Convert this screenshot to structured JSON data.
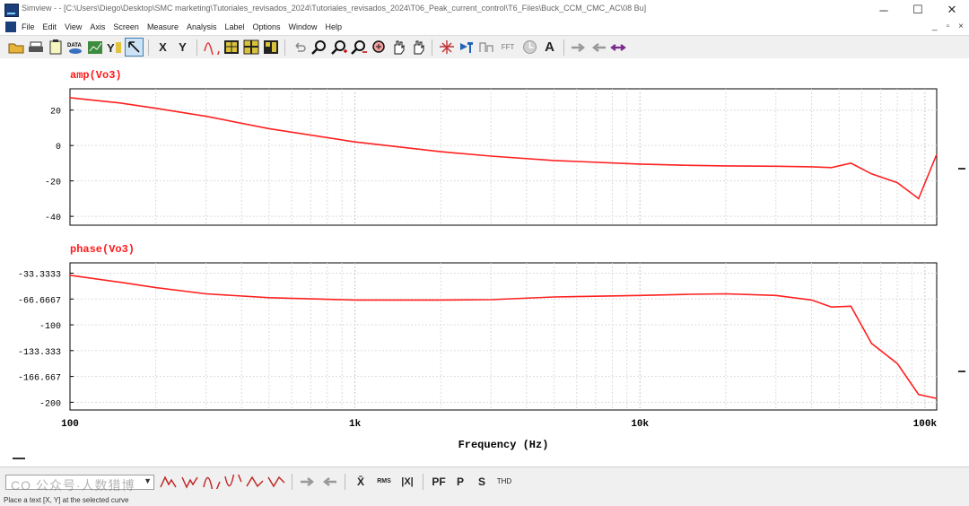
{
  "window": {
    "title": "Simview - - [C:\\Users\\Diego\\Desktop\\SMC marketing\\Tutoriales_revisados_2024\\Tutoriales_revisados_2024\\T06_Peak_current_control\\T6_Files\\Buck_CCM_CMC_AC\\08 Bu]",
    "minimize_glyph": "─",
    "maximize_glyph": "☐",
    "close_glyph": "✕"
  },
  "menu": {
    "items": [
      "File",
      "Edit",
      "View",
      "Axis",
      "Screen",
      "Measure",
      "Analysis",
      "Label",
      "Options",
      "Window",
      "Help"
    ],
    "mdi": [
      "_",
      "▫",
      "×"
    ]
  },
  "toolbar": {
    "data_label": "DATA",
    "x_label": "X",
    "y_label": "Y",
    "fft_label": "FFT",
    "text_label": "A",
    "icons": [
      "open-folder-icon",
      "print-icon",
      "clipboard-icon",
      "data-icon",
      "chart-icon",
      "axis-icon",
      "select-arrow-icon",
      "x-axis-icon",
      "y-axis-icon",
      "waveform-icon",
      "grid-icon",
      "screen-icon",
      "screen2-icon",
      "undo-icon",
      "zoom-icon",
      "zoom-in-icon",
      "zoom-out-icon",
      "zoom-fit-icon",
      "pan-icon",
      "hand-icon",
      "measure-icon",
      "probe-icon",
      "analysis-icon",
      "fft-icon",
      "clock-icon",
      "text-icon",
      "arrow-right-icon",
      "arrow-left-icon",
      "arrow-both-icon"
    ]
  },
  "colors": {
    "curve": "#ff2020",
    "title": "#ff1a1a",
    "grid": "#dcdcdc",
    "axis_text": "#000000"
  },
  "chart_data": [
    {
      "type": "line",
      "title": "amp(Vo3)",
      "xlabel": "Frequency (Hz)",
      "xscale": "log",
      "xlim": [
        100,
        110000
      ],
      "ylim": [
        -45,
        32
      ],
      "yticks": [
        20,
        0,
        -20,
        -40
      ],
      "series": [
        {
          "x": [
            100,
            150,
            200,
            300,
            500,
            1000,
            2000,
            3000,
            5000,
            10000,
            15000,
            20000,
            30000,
            40000,
            47000,
            55000,
            65000,
            80000,
            95000,
            110000
          ],
          "y": [
            27,
            24,
            21,
            16.5,
            9.5,
            2,
            -3.5,
            -6,
            -8.5,
            -10.5,
            -11.2,
            -11.5,
            -11.7,
            -12,
            -12.5,
            -10,
            -16,
            -21,
            -30,
            -5
          ]
        }
      ]
    },
    {
      "type": "line",
      "title": "phase(Vo3)",
      "xlabel": "Frequency (Hz)",
      "xscale": "log",
      "xlim": [
        100,
        110000
      ],
      "ylim": [
        -210,
        -20
      ],
      "yticks": [
        "-33.3333",
        "-66.6667",
        "-100",
        "-133.333",
        "-166.667",
        "-200"
      ],
      "xticks": [
        "100",
        "1k",
        "10k",
        "100k"
      ],
      "series": [
        {
          "x": [
            100,
            150,
            200,
            300,
            500,
            1000,
            2000,
            3000,
            5000,
            10000,
            15000,
            20000,
            30000,
            40000,
            47000,
            55000,
            65000,
            80000,
            95000,
            110000
          ],
          "y": [
            -36,
            -45,
            -52,
            -60,
            -65,
            -68,
            -68,
            -67.5,
            -64,
            -62,
            -60.5,
            -60,
            -62,
            -68,
            -77,
            -76,
            -124,
            -150,
            -190,
            -195
          ]
        }
      ]
    }
  ],
  "bottombar": {
    "tools": [
      "X̄",
      "RMS",
      "|X|",
      "PF",
      "P",
      "S",
      "THD"
    ]
  },
  "status": "Place a text [X, Y] at the selected curve",
  "watermark": "CO 公众号·人数猎博"
}
